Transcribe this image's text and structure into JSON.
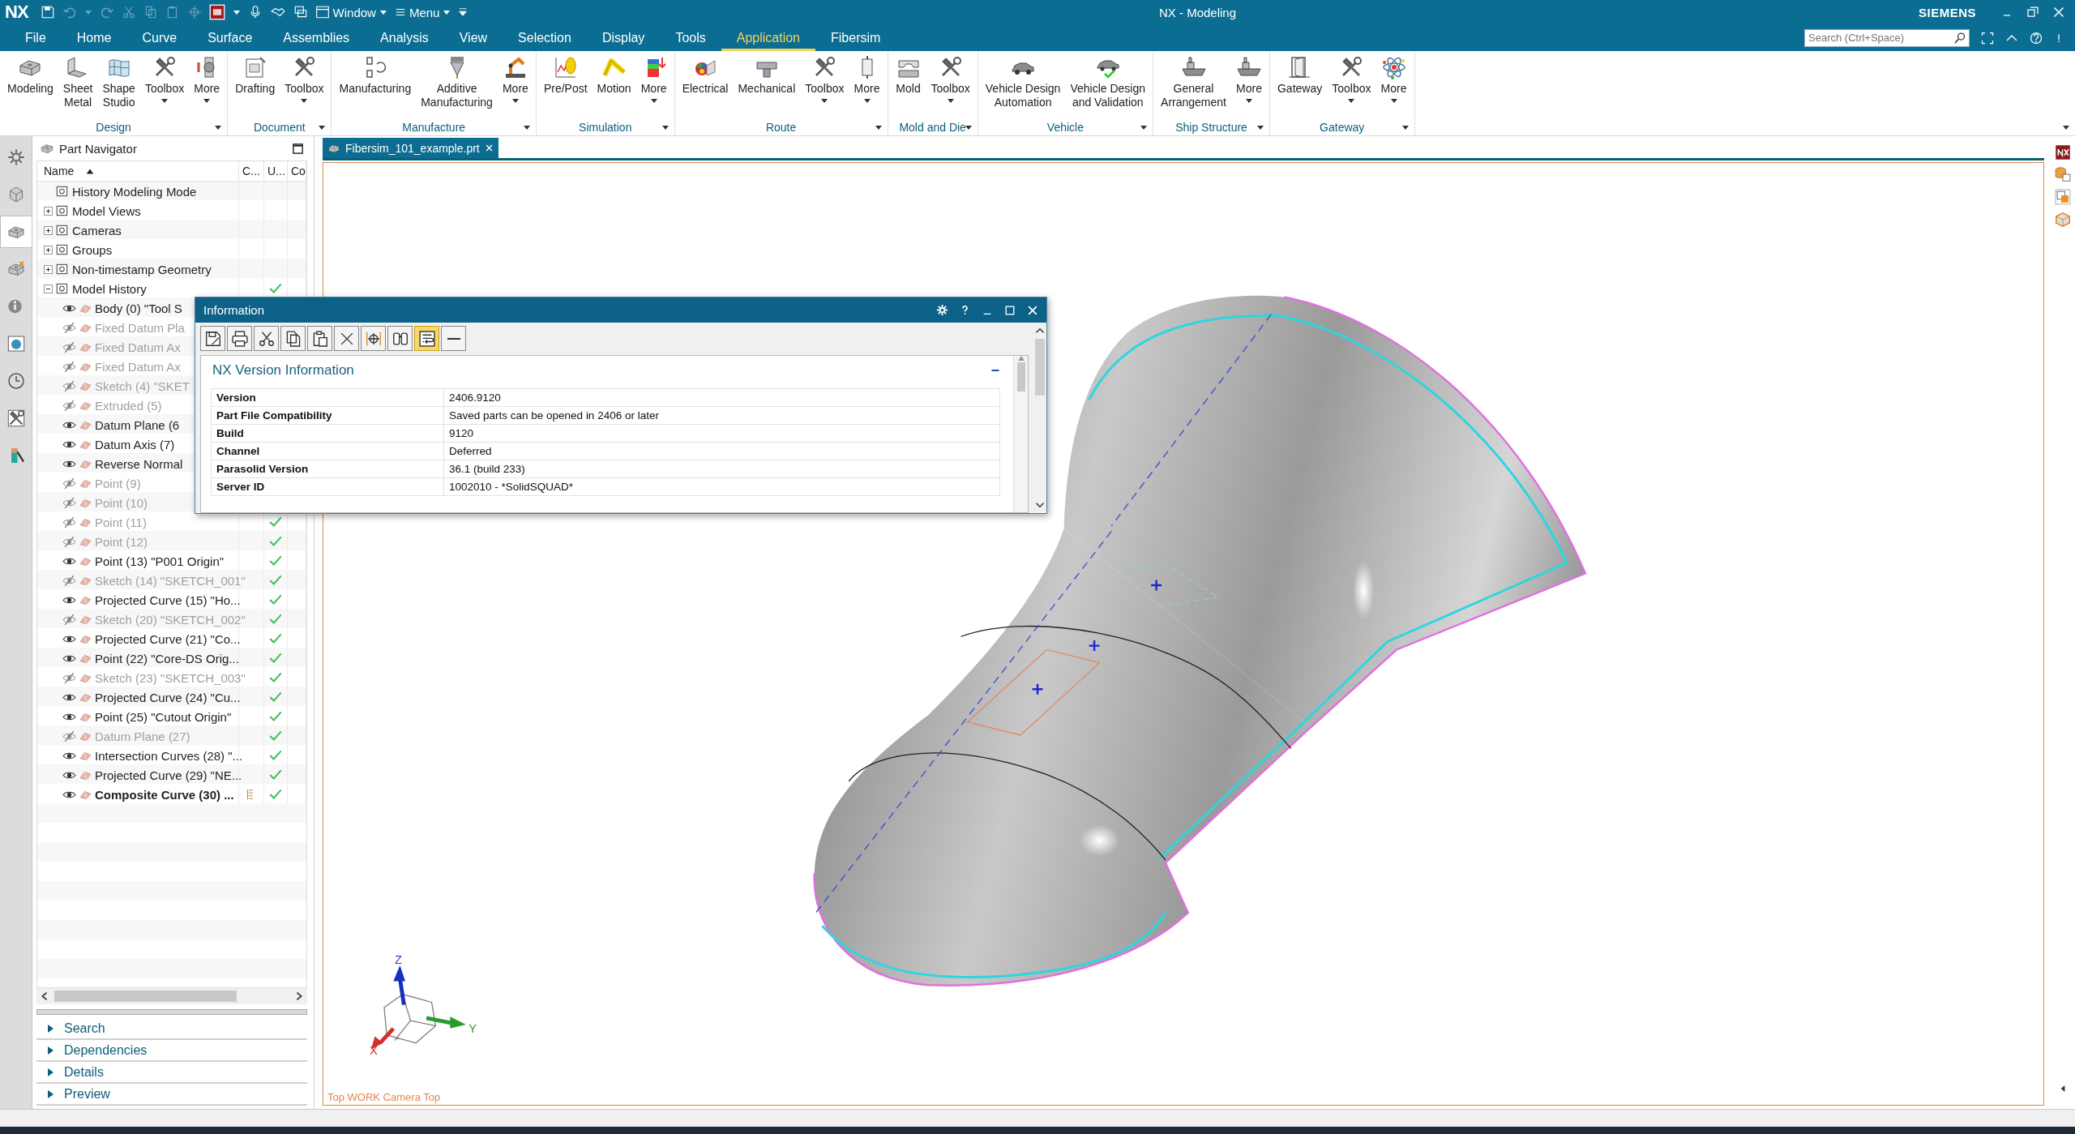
{
  "title_bar": {
    "logo": "NX",
    "window_menu": "Window",
    "main_menu": "Menu",
    "title": "NX - Modeling",
    "brand": "SIEMENS",
    "search": {
      "placeholder": "Search (Ctrl+Space)"
    }
  },
  "menu_tabs": [
    {
      "label": "File",
      "selected": false
    },
    {
      "label": "Home",
      "selected": false
    },
    {
      "label": "Curve",
      "selected": false
    },
    {
      "label": "Surface",
      "selected": false
    },
    {
      "label": "Assemblies",
      "selected": false
    },
    {
      "label": "Analysis",
      "selected": false
    },
    {
      "label": "View",
      "selected": false
    },
    {
      "label": "Selection",
      "selected": false
    },
    {
      "label": "Display",
      "selected": false
    },
    {
      "label": "Tools",
      "selected": false
    },
    {
      "label": "Application",
      "selected": true
    },
    {
      "label": "Fibersim",
      "selected": false
    }
  ],
  "ribbon": [
    {
      "label": "Design",
      "buttons": [
        {
          "label": "Modeling",
          "menu": false
        },
        {
          "label": "Sheet\nMetal",
          "menu": false
        },
        {
          "label": "Shape\nStudio",
          "menu": false
        },
        {
          "label": "Toolbox",
          "menu": true
        },
        {
          "label": "More",
          "menu": true
        }
      ]
    },
    {
      "label": "Document",
      "buttons": [
        {
          "label": "Drafting",
          "menu": false
        },
        {
          "label": "Toolbox",
          "menu": true
        }
      ]
    },
    {
      "label": "Manufacture",
      "buttons": [
        {
          "label": "Manufacturing",
          "menu": false
        },
        {
          "label": "Additive\nManufacturing",
          "menu": false
        },
        {
          "label": "More",
          "menu": true
        }
      ]
    },
    {
      "label": "Simulation",
      "buttons": [
        {
          "label": "Pre/Post",
          "menu": false
        },
        {
          "label": "Motion",
          "menu": false
        },
        {
          "label": "More",
          "menu": true
        }
      ]
    },
    {
      "label": "Route",
      "buttons": [
        {
          "label": "Electrical",
          "menu": false
        },
        {
          "label": "Mechanical",
          "menu": false
        },
        {
          "label": "Toolbox",
          "menu": true
        },
        {
          "label": "More",
          "menu": true
        }
      ]
    },
    {
      "label": "Mold and Die",
      "buttons": [
        {
          "label": "Mold",
          "menu": false
        },
        {
          "label": "Toolbox",
          "menu": true
        }
      ]
    },
    {
      "label": "Vehicle",
      "buttons": [
        {
          "label": "Vehicle Design\nAutomation",
          "menu": false
        },
        {
          "label": "Vehicle Design\nand Validation",
          "menu": false
        }
      ]
    },
    {
      "label": "Ship Structure",
      "buttons": [
        {
          "label": "General\nArrangement",
          "menu": false
        },
        {
          "label": "More",
          "menu": true
        }
      ]
    },
    {
      "label": "Gateway",
      "buttons": [
        {
          "label": "Gateway",
          "menu": false
        },
        {
          "label": "Toolbox",
          "menu": true
        },
        {
          "label": "More",
          "menu": true
        }
      ]
    }
  ],
  "resource_bar": [
    {
      "selected": false
    },
    {
      "selected": false
    },
    {
      "selected": true
    },
    {
      "selected": false
    },
    {
      "selected": false
    },
    {
      "selected": false
    },
    {
      "selected": false
    },
    {
      "selected": false
    },
    {
      "selected": false
    }
  ],
  "navigator": {
    "title": "Part Navigator",
    "columns": [
      "Name",
      "C...",
      "U...",
      "Co"
    ],
    "nodes": [
      {
        "label": "History Modeling Mode",
        "up_to_date": false
      },
      {
        "label": "Model Views",
        "expanded": false,
        "up_to_date": false
      },
      {
        "label": "Cameras",
        "expanded": false,
        "up_to_date": false
      },
      {
        "label": "Groups",
        "expanded": false,
        "up_to_date": false
      },
      {
        "label": "Non-timestamp Geometry",
        "expanded": false,
        "up_to_date": false
      },
      {
        "label": "Model History",
        "expanded": true,
        "up_to_date": true,
        "children": [
          {
            "label": "Body (0) \"Tool S",
            "shown": true,
            "current": false
          },
          {
            "label": "Fixed Datum Pla",
            "shown": false,
            "current": false
          },
          {
            "label": "Fixed Datum Ax",
            "shown": false,
            "current": false
          },
          {
            "label": "Fixed Datum Ax",
            "shown": false,
            "current": false
          },
          {
            "label": "Sketch (4) \"SKET",
            "shown": false,
            "current": false
          },
          {
            "label": "Extruded (5)",
            "shown": false,
            "current": false
          },
          {
            "label": "Datum Plane (6",
            "shown": true,
            "current": false
          },
          {
            "label": "Datum Axis (7)",
            "shown": true,
            "current": false
          },
          {
            "label": "Reverse Normal",
            "shown": true,
            "current": false
          },
          {
            "label": "Point (9)",
            "shown": false,
            "current": false
          },
          {
            "label": "Point (10)",
            "shown": false,
            "current": false
          },
          {
            "label": "Point (11)",
            "shown": false,
            "up_to_date": true,
            "current": false
          },
          {
            "label": "Point (12)",
            "shown": false,
            "up_to_date": true,
            "current": false
          },
          {
            "label": "Point (13) \"P001 Origin\"",
            "shown": true,
            "up_to_date": true,
            "current": false
          },
          {
            "label": "Sketch (14) \"SKETCH_001\"",
            "shown": false,
            "up_to_date": true,
            "current": false
          },
          {
            "label": "Projected Curve (15) \"Ho...",
            "shown": true,
            "up_to_date": true,
            "current": false
          },
          {
            "label": "Sketch (20) \"SKETCH_002\"",
            "shown": false,
            "up_to_date": true,
            "current": false
          },
          {
            "label": "Projected Curve (21) \"Co...",
            "shown": true,
            "up_to_date": true,
            "current": false
          },
          {
            "label": "Point (22) \"Core-DS Orig...",
            "shown": true,
            "up_to_date": true,
            "current": false
          },
          {
            "label": "Sketch (23) \"SKETCH_003\"",
            "shown": false,
            "up_to_date": true,
            "current": false
          },
          {
            "label": "Projected Curve (24) \"Cu...",
            "shown": true,
            "up_to_date": true,
            "current": false
          },
          {
            "label": "Point (25) \"Cutout Origin\"",
            "shown": true,
            "up_to_date": true,
            "current": false
          },
          {
            "label": "Datum Plane (27)",
            "shown": false,
            "up_to_date": true,
            "current": false
          },
          {
            "label": "Intersection Curves (28) \"...",
            "shown": true,
            "up_to_date": true,
            "current": false
          },
          {
            "label": "Projected Curve (29) \"NE...",
            "shown": true,
            "up_to_date": true,
            "current": false
          },
          {
            "label": "Composite Curve (30) ...",
            "shown": true,
            "up_to_date": true,
            "current": true
          }
        ]
      }
    ],
    "sections": [
      {
        "label": "Search",
        "expanded": false
      },
      {
        "label": "Dependencies",
        "expanded": false
      },
      {
        "label": "Details",
        "expanded": false
      },
      {
        "label": "Preview",
        "expanded": false
      }
    ]
  },
  "graphics": {
    "document_tab": {
      "label": "Fibersim_101_example.prt",
      "selected": true
    },
    "view_label": "Top WORK Camera Top",
    "triad": {
      "x": "X",
      "y": "Y",
      "z": "Z"
    }
  },
  "info_dialog": {
    "title": "Information",
    "toolbar": [
      {
        "on": false
      },
      {
        "on": false
      },
      {
        "on": false
      },
      {
        "on": false
      },
      {
        "on": false
      },
      {
        "on": false
      },
      {
        "on": false
      },
      {
        "on": false
      },
      {
        "on": true
      },
      {
        "on": false
      }
    ],
    "heading": "NX Version Information",
    "rows": [
      {
        "label": "Version",
        "value": "2406.9120"
      },
      {
        "label": "Part File Compatibility",
        "value": "Saved parts can be opened in 2406 or later"
      },
      {
        "label": "Build",
        "value": "9120"
      },
      {
        "label": "Channel",
        "value": "Deferred"
      },
      {
        "label": "Parasolid Version",
        "value": "36.1 (build 233)"
      },
      {
        "label": "Server ID",
        "value": "1002010 - *SolidSQUAD*"
      }
    ]
  }
}
